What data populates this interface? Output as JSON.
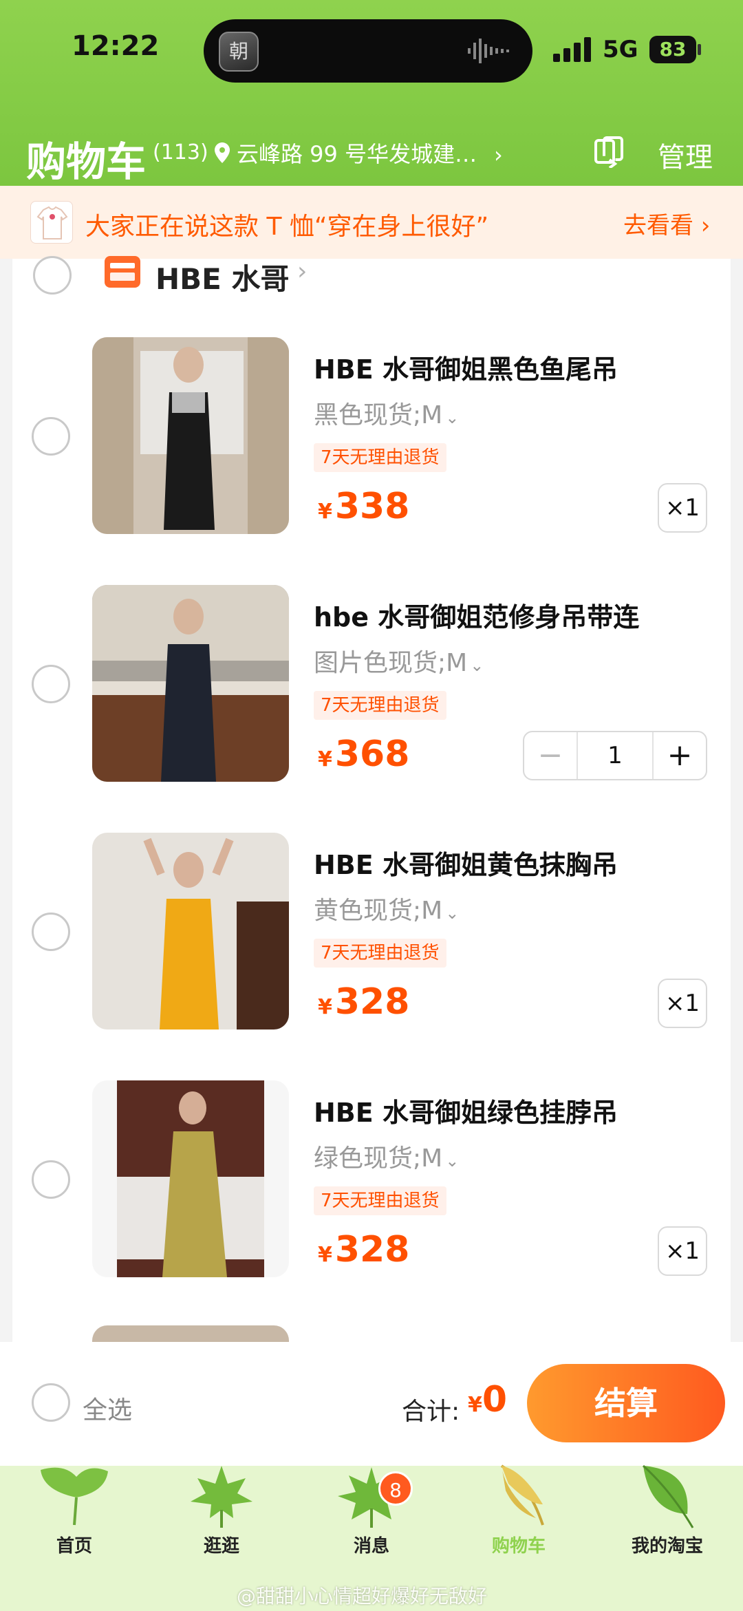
{
  "status_bar": {
    "time": "12:22",
    "network": "5G",
    "battery": "83",
    "island_app_glyph": "朝"
  },
  "header": {
    "title": "购物车",
    "count": "(113)",
    "address": "云峰路 99 号华发城建…",
    "manage_label": "管理"
  },
  "banner": {
    "text": "大家正在说这款 T 恤“穿在身上很好”",
    "link": "去看看 ›"
  },
  "shop": {
    "name": "HBE 水哥"
  },
  "items": [
    {
      "title": "HBE 水哥御姐黑色鱼尾吊",
      "sku": "黑色现货;M",
      "tag": "7天无理由退货",
      "price": "338",
      "qty": "×1"
    },
    {
      "title": "hbe 水哥御姐范修身吊带连",
      "sku": "图片色现货;M",
      "tag": "7天无理由退货",
      "price": "368",
      "qty": "1"
    },
    {
      "title": "HBE 水哥御姐黄色抹胸吊",
      "sku": "黄色现货;M",
      "tag": "7天无理由退货",
      "price": "328",
      "qty": "×1"
    },
    {
      "title": "HBE 水哥御姐绿色挂脖吊",
      "sku": "绿色现货;M",
      "tag": "7天无理由退货",
      "price": "328",
      "qty": "×1"
    }
  ],
  "checkout": {
    "select_all": "全选",
    "total_label": "合计:",
    "currency": "¥",
    "total": "0",
    "button": "结算"
  },
  "tabs": [
    {
      "label": "首页",
      "icon": "ginkgo-leaf-icon"
    },
    {
      "label": "逛逛",
      "icon": "maple-leaf-icon"
    },
    {
      "label": "消息",
      "icon": "maple-leaf-icon",
      "badge": "8"
    },
    {
      "label": "购物车",
      "icon": "palm-leaf-icon",
      "active": true
    },
    {
      "label": "我的淘宝",
      "icon": "leaf-icon"
    }
  ],
  "watermark": "@甜甜小心情超好爆好无敌好",
  "colors": {
    "header": "#8fd24e",
    "accent": "#ff5000",
    "tabbar": "#e6f6cf"
  }
}
